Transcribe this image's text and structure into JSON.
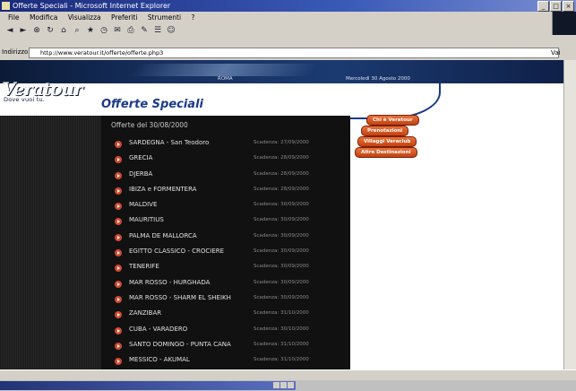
{
  "window": {
    "title": "Offerte Speciali - Microsoft Internet Explorer",
    "controls": [
      "_",
      "□",
      "×"
    ]
  },
  "menu": [
    "File",
    "Modifica",
    "Visualizza",
    "Preferiti",
    "Strumenti",
    "?"
  ],
  "address": {
    "label": "Indirizzo",
    "url": "http://www.veratour.it/offerte/offerte.php3",
    "go": "Vai"
  },
  "banner": {
    "location": "ROMA",
    "date": "Mercoledì 30 Agosto 2000"
  },
  "brand": {
    "logo": "Veratour",
    "tagline": "Dove vuoi tu."
  },
  "page": {
    "title": "Offerte Speciali",
    "offers_header": "Offerte del 30/08/2000"
  },
  "offers": [
    {
      "name": "SARDEGNA - San Teodoro",
      "expiry": "Scadenza: 27/09/2000"
    },
    {
      "name": "GRECIA",
      "expiry": "Scadenza: 28/09/2000"
    },
    {
      "name": "DJERBA",
      "expiry": "Scadenza: 28/09/2000"
    },
    {
      "name": "IBIZA e FORMENTERA",
      "expiry": "Scadenza: 28/09/2000"
    },
    {
      "name": "MALDIVE",
      "expiry": "Scadenza: 30/09/2000"
    },
    {
      "name": "MAURITIUS",
      "expiry": "Scadenza: 30/09/2000"
    },
    {
      "name": "PALMA DE MALLORCA",
      "expiry": "Scadenza: 30/09/2000"
    },
    {
      "name": "EGITTO CLASSICO - CROCIERE",
      "expiry": "Scadenza: 30/09/2000"
    },
    {
      "name": "TENERIFE",
      "expiry": "Scadenza: 30/09/2000"
    },
    {
      "name": "MAR ROSSO - HURGHADA",
      "expiry": "Scadenza: 30/09/2000"
    },
    {
      "name": "MAR ROSSO - SHARM EL SHEIKH",
      "expiry": "Scadenza: 30/09/2000"
    },
    {
      "name": "ZANZIBAR",
      "expiry": "Scadenza: 31/10/2000"
    },
    {
      "name": "CUBA - VARADERO",
      "expiry": "Scadenza: 30/10/2000"
    },
    {
      "name": "SANTO DOMINGO - PUNTA CANA",
      "expiry": "Scadenza: 31/10/2000"
    },
    {
      "name": "MESSICO - AKUMAL",
      "expiry": "Scadenza: 31/10/2000"
    }
  ],
  "side_menu": [
    "Chi è Veratour",
    "Prenotazioni",
    "Villaggi Veraclub",
    "Altre Destinazioni"
  ],
  "toolbar_icons": [
    "back-icon",
    "forward-icon",
    "stop-icon",
    "refresh-icon",
    "home-icon",
    "search-icon",
    "favorites-icon",
    "history-icon",
    "mail-icon",
    "print-icon",
    "edit-icon",
    "discuss-icon",
    "messenger-icon"
  ],
  "colors": {
    "banner": "#163060",
    "panel": "#111111",
    "accent": "#d04830",
    "title": "#1a3a8a"
  }
}
